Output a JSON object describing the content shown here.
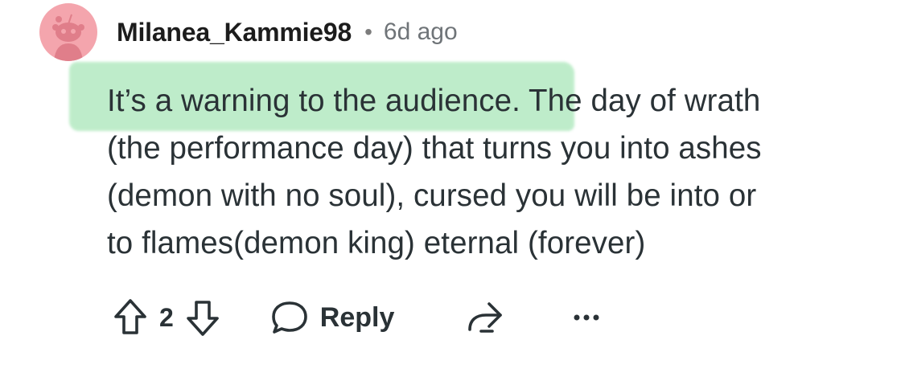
{
  "comment": {
    "username": "Milanea_Kammie98",
    "separator": "•",
    "timestamp": "6d ago",
    "lines": [
      {
        "highlighted": "It’s a warning to the audience.",
        "rest": " The day of wrath"
      },
      "(the performance day) that turns you into ashes",
      "(demon with no soul), cursed you will be into or",
      "to flames(demon king) eternal (forever)"
    ],
    "highlight_color": "#b8ebc5",
    "avatar_color": "#f4a5ad"
  },
  "actions": {
    "upvote_icon": "arrow-up-icon",
    "vote_count": "2",
    "downvote_icon": "arrow-down-icon",
    "reply_icon": "speech-bubble-icon",
    "reply_label": "Reply",
    "share_icon": "share-arrow-icon",
    "more_icon": "more-dots-icon"
  }
}
